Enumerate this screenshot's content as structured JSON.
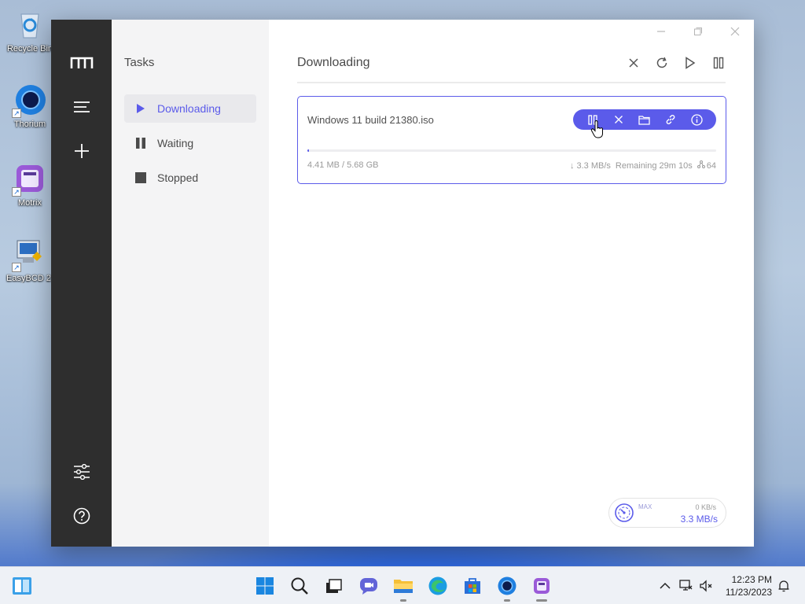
{
  "desktop": {
    "icons": [
      {
        "label": "Recycle Bin",
        "icon": "recycle-bin-icon"
      },
      {
        "label": "Thorium",
        "icon": "thorium-browser-icon"
      },
      {
        "label": "Motrix",
        "icon": "motrix-icon"
      },
      {
        "label": "EasyBCD 2.",
        "icon": "easybcd-icon"
      }
    ]
  },
  "app": {
    "name": "Motrix",
    "rail": {
      "items": [
        "logo-icon",
        "menu-icon",
        "add-icon",
        "preferences-icon",
        "help-icon"
      ]
    },
    "sidebar": {
      "title": "Tasks",
      "items": [
        {
          "label": "Downloading",
          "icon": "play-icon",
          "active": true
        },
        {
          "label": "Waiting",
          "icon": "pause-icon",
          "active": false
        },
        {
          "label": "Stopped",
          "icon": "stop-icon",
          "active": false
        }
      ]
    },
    "main": {
      "title": "Downloading",
      "toolbar": [
        "delete-all-icon",
        "refresh-icon",
        "resume-all-icon",
        "pause-all-icon"
      ]
    },
    "task": {
      "name": "Windows 11 build 21380.iso",
      "size": "4.41 MB / 5.68 GB",
      "speed": "↓ 3.3 MB/s",
      "remaining": "Remaining 29m 10s",
      "connections": "64",
      "progress": 0.001,
      "actions": [
        "pause-icon",
        "delete-icon",
        "folder-icon",
        "link-icon",
        "info-icon"
      ]
    },
    "speedometer": {
      "max_label": "MAX",
      "upload": "0 KB/s",
      "download": "3.3 MB/s"
    }
  },
  "taskbar": {
    "time": "12:23 PM",
    "date": "11/23/2023",
    "apps": [
      "start-icon",
      "search-icon",
      "task-view-icon",
      "chat-icon",
      "file-explorer-icon",
      "edge-icon",
      "store-icon",
      "thorium-icon",
      "motrix-taskbar-icon"
    ]
  },
  "colors": {
    "accent": "#5b5bea",
    "rail": "#2e2e2e",
    "sidebar": "#f4f4f5"
  }
}
